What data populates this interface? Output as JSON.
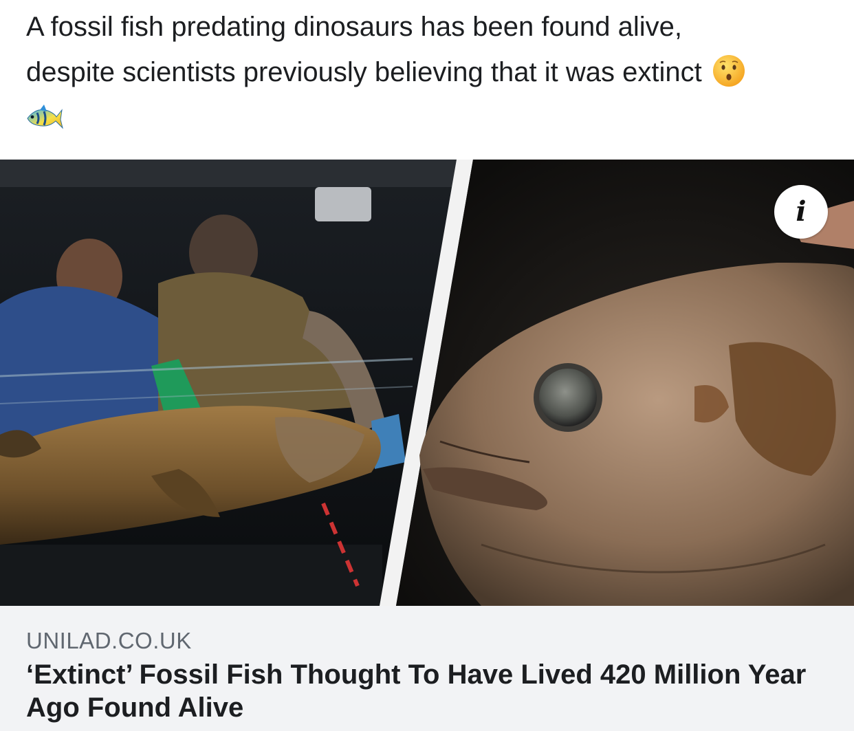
{
  "post": {
    "text_line1": "A fossil fish predating dinosaurs has been found alive,",
    "text_line2": "despite scientists previously believing that it was extinct",
    "emojis": [
      "hushed-face-icon",
      "tropical-fish-icon"
    ]
  },
  "link_preview": {
    "info_icon": "i",
    "domain": "UNILAD.CO.UK",
    "headline": "‘Extinct’ Fossil Fish Thought To Have Lived 420 Million Year Ago Found Alive"
  },
  "colors": {
    "text": "#1c1e21",
    "domain_text": "#606770",
    "caption_bg": "#f2f3f5"
  }
}
